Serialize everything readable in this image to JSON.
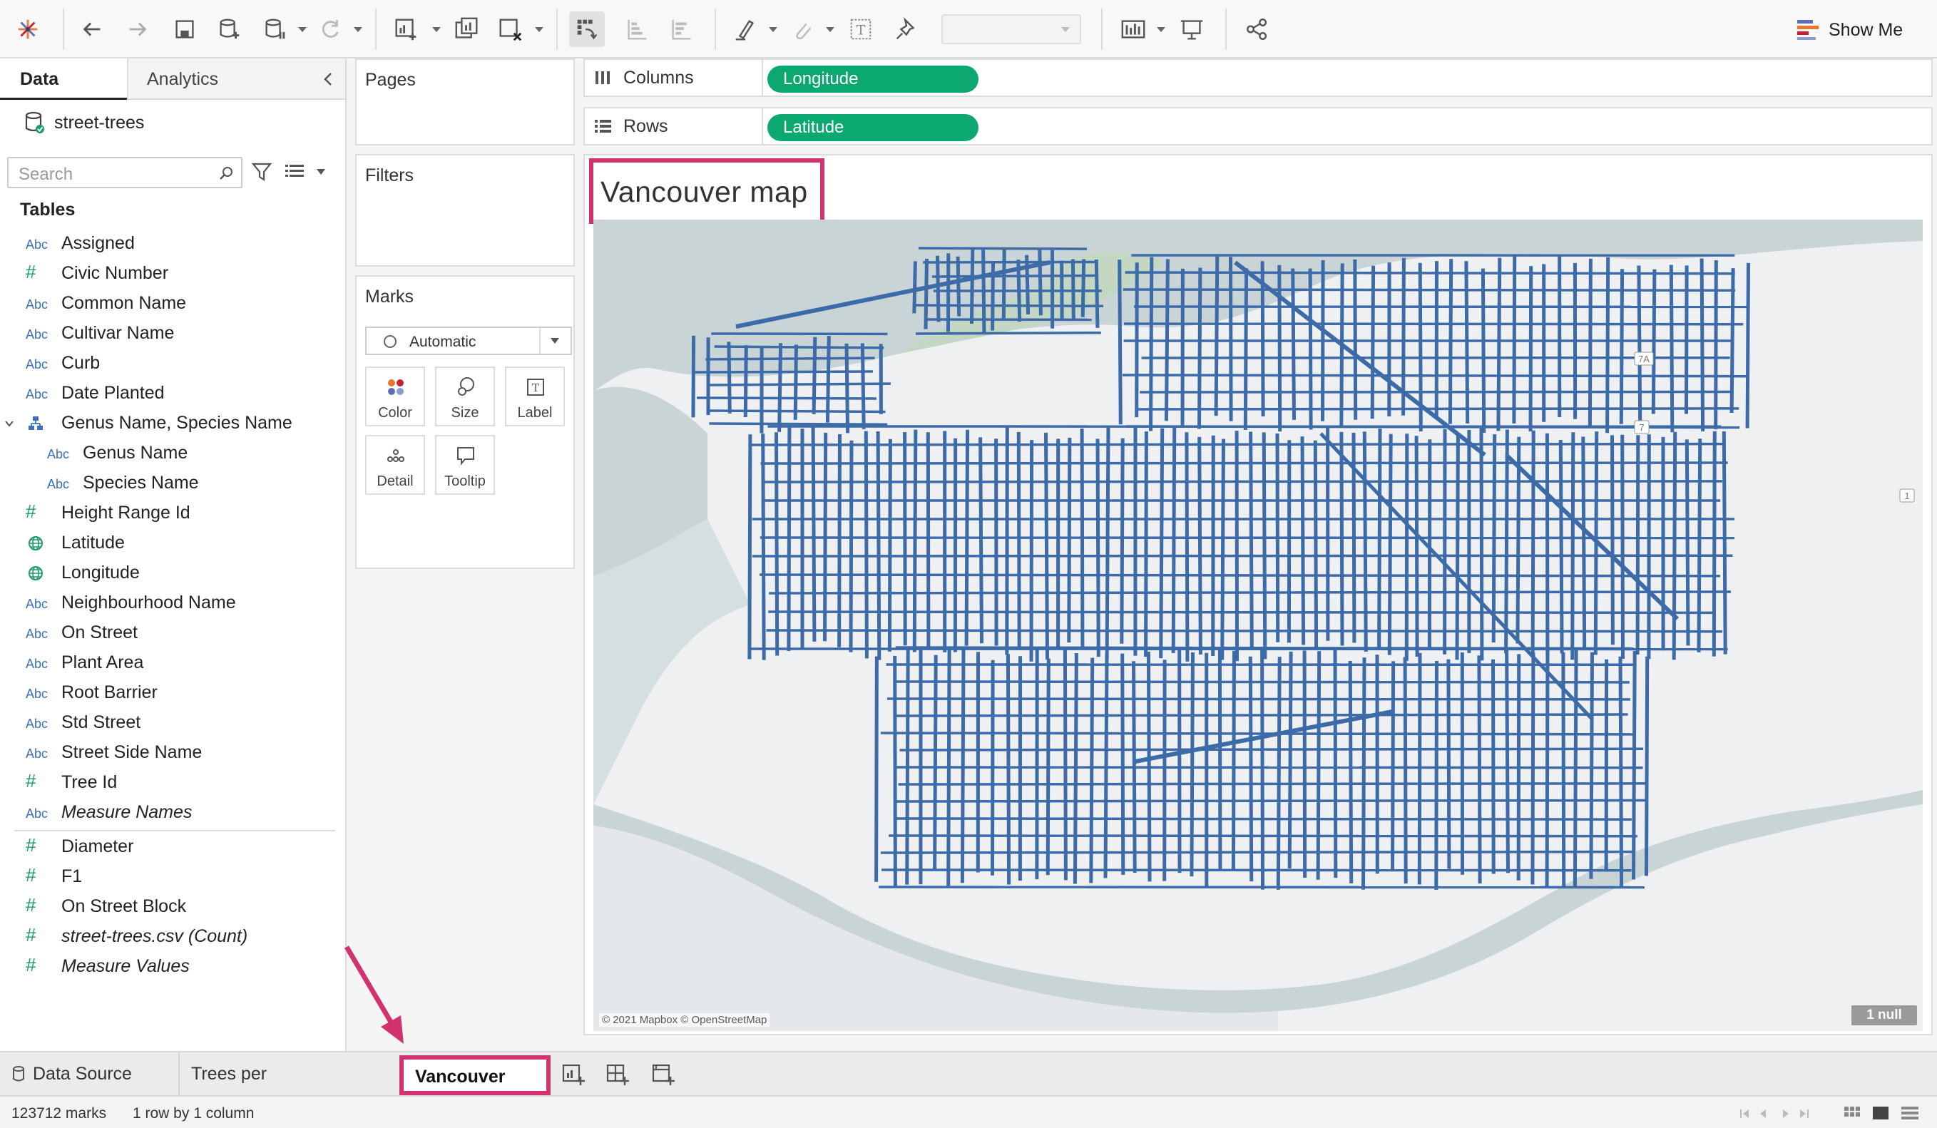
{
  "toolbar": {
    "show_me_label": "Show Me"
  },
  "data_pane": {
    "tab_data": "Data",
    "tab_analytics": "Analytics",
    "datasource_name": "street-trees",
    "search_placeholder": "Search",
    "tables_heading": "Tables",
    "fields": [
      {
        "type": "Abc",
        "name": "Assigned"
      },
      {
        "type": "#",
        "name": "Civic Number"
      },
      {
        "type": "Abc",
        "name": "Common Name"
      },
      {
        "type": "Abc",
        "name": "Cultivar Name"
      },
      {
        "type": "Abc",
        "name": "Curb"
      },
      {
        "type": "Abc",
        "name": "Date Planted"
      },
      {
        "type": "hier",
        "name": "Genus Name, Species Name"
      },
      {
        "type": "Abc",
        "name": "Genus Name"
      },
      {
        "type": "Abc",
        "name": "Species Name"
      },
      {
        "type": "#",
        "name": "Height Range Id"
      },
      {
        "type": "geo",
        "name": "Latitude"
      },
      {
        "type": "geo",
        "name": "Longitude"
      },
      {
        "type": "Abc",
        "name": "Neighbourhood Name"
      },
      {
        "type": "Abc",
        "name": "On Street"
      },
      {
        "type": "Abc",
        "name": "Plant Area"
      },
      {
        "type": "Abc",
        "name": "Root Barrier"
      },
      {
        "type": "Abc",
        "name": "Std Street"
      },
      {
        "type": "Abc",
        "name": "Street Side Name"
      },
      {
        "type": "#",
        "name": "Tree Id"
      },
      {
        "type": "Abc",
        "name": "Measure Names"
      }
    ],
    "measures": [
      {
        "type": "#",
        "name": "Diameter"
      },
      {
        "type": "#",
        "name": "F1"
      },
      {
        "type": "#",
        "name": "On Street Block"
      },
      {
        "type": "#",
        "name": "street-trees.csv (Count)"
      },
      {
        "type": "#",
        "name": "Measure Values"
      }
    ]
  },
  "shelves": {
    "pages_label": "Pages",
    "filters_label": "Filters",
    "marks_label": "Marks",
    "mark_type": "Automatic",
    "mark_buttons": [
      "Color",
      "Size",
      "Label",
      "Detail",
      "Tooltip"
    ],
    "columns_label": "Columns",
    "columns_pill": "Longitude",
    "rows_label": "Rows",
    "rows_pill": "Latitude"
  },
  "view": {
    "title": "Vancouver map",
    "attribution": "© 2021 Mapbox © OpenStreetMap",
    "null_badge": "1 null",
    "highway_labels": [
      "7A",
      "7",
      "1"
    ],
    "mark_color": "#3d6ba8",
    "highlight_color": "#d2336f"
  },
  "sheet_tabs": {
    "data_source": "Data Source",
    "tab1": "Trees per Neighbourhood",
    "tab2": "Vancouver map"
  },
  "status_bar": {
    "marks": "123712 marks",
    "layout": "1 row by 1 column"
  }
}
